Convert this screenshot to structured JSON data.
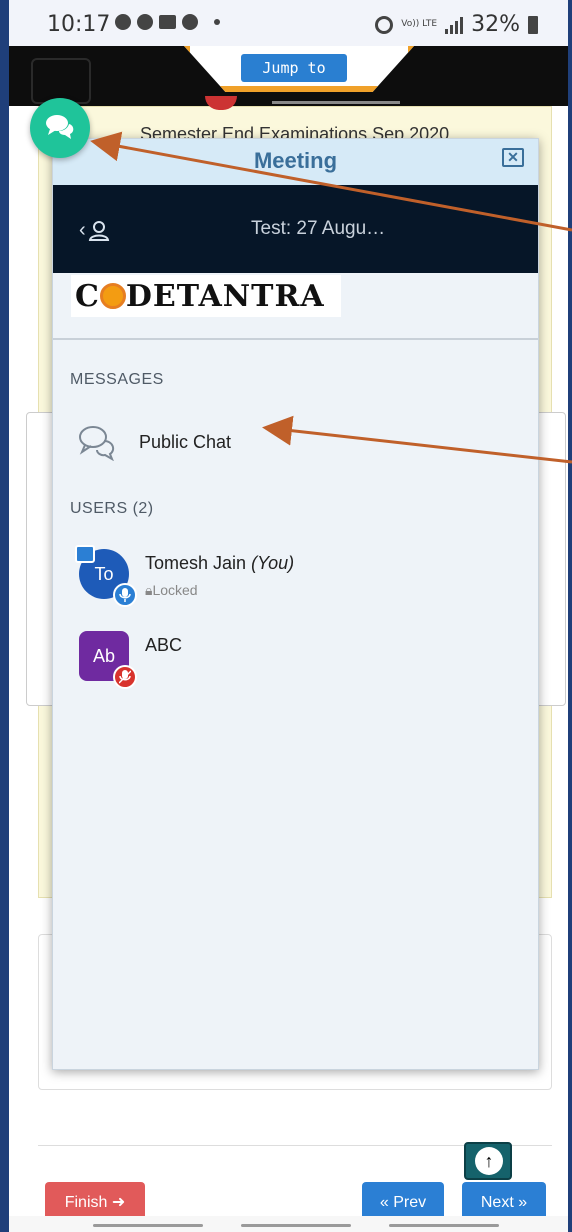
{
  "status_bar": {
    "time": "10:17",
    "network": "Vo)) LTE",
    "battery": "32%",
    "icons": [
      "chrome-icon",
      "whatsapp-icon",
      "message-icon",
      "jio-icon",
      "alarm-icon",
      "signal-icon",
      "battery-icon"
    ]
  },
  "header": {
    "jump_label": "Jump to",
    "menu_icon": "hamburger-icon"
  },
  "page": {
    "heading": "Semester End Examinations Sep 2020"
  },
  "meeting": {
    "title": "Meeting",
    "close_icon": "close-icon",
    "session_title": "Test: 27 Augu…",
    "brand": {
      "pre": "C",
      "post": "DETANTRA"
    },
    "messages_label": "MESSAGES",
    "public_chat_label": "Public Chat",
    "users_label": "USERS (2)",
    "users": [
      {
        "initials": "To",
        "name": "Tomesh Jain",
        "you_tag": "(You)",
        "status": "Locked",
        "mic": "on",
        "presenter": true
      },
      {
        "initials": "Ab",
        "name": "ABC",
        "mic": "off",
        "presenter": false
      }
    ]
  },
  "footer": {
    "finish_label": "Finish",
    "prev_label": "« Prev",
    "next_label": "Next »"
  },
  "colors": {
    "fab": "#1fc49a",
    "session_bar": "#061628",
    "title_bar": "#d6eaf7",
    "finish": "#e15a5a",
    "nav": "#2b7fd4",
    "arrow": "#c0602a"
  }
}
